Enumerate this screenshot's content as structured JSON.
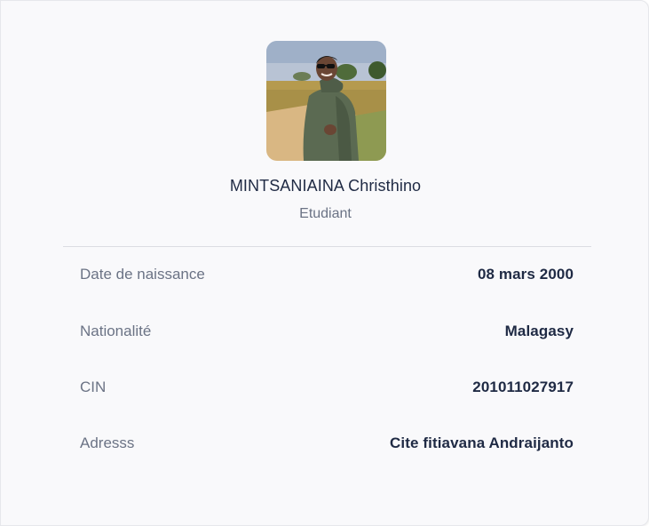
{
  "profile": {
    "name": "MINTSANIAINA Christhino",
    "role": "Etudiant"
  },
  "details": {
    "birth_date": {
      "label": "Date de naissance",
      "value": "08 mars 2000"
    },
    "nationality": {
      "label": "Nationalité",
      "value": "Malagasy"
    },
    "cin": {
      "label": "CIN",
      "value": "201011027917"
    },
    "address": {
      "label": "Adresss",
      "value": "Cite fitiavana Andraijanto"
    }
  },
  "colors": {
    "card_background": "#f9f9fb",
    "primary_text": "#1f2a44",
    "secondary_text": "#6b7385",
    "divider": "#dcdde2"
  }
}
